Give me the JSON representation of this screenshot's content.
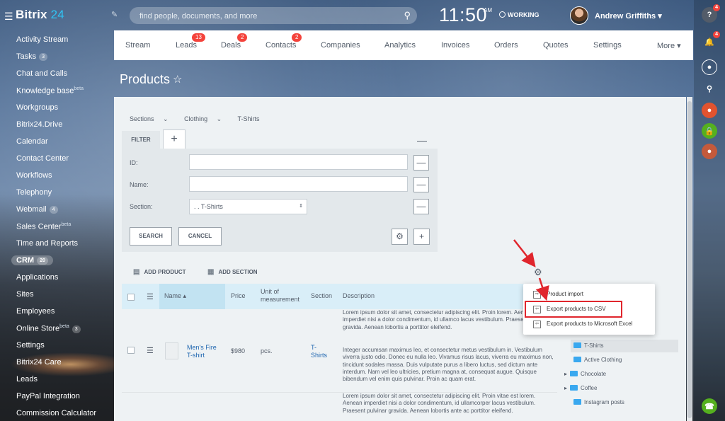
{
  "app": {
    "logo_text": "Bitrix",
    "logo_number": "24"
  },
  "search": {
    "placeholder": "find people, documents, and more"
  },
  "clock": {
    "time": "11:50",
    "ampm": "AM",
    "status": "WORKING"
  },
  "user": {
    "name": "Andrew Griffiths"
  },
  "rightbar": {
    "help_badge": "4",
    "notif_badge": "4"
  },
  "sidebar": {
    "items": [
      {
        "label": "Activity Stream"
      },
      {
        "label": "Tasks",
        "count": "3"
      },
      {
        "label": "Chat and Calls"
      },
      {
        "label": "Knowledge base",
        "sup": "beta"
      },
      {
        "label": "Workgroups"
      },
      {
        "label": "Bitrix24.Drive"
      },
      {
        "label": "Calendar"
      },
      {
        "label": "Contact Center"
      },
      {
        "label": "Workflows"
      },
      {
        "label": "Telephony"
      },
      {
        "label": "Webmail",
        "count": "4"
      },
      {
        "label": "Sales Center",
        "sup": "beta"
      },
      {
        "label": "Time and Reports"
      },
      {
        "label": "CRM",
        "count": "20"
      },
      {
        "label": "Applications"
      },
      {
        "label": "Sites"
      },
      {
        "label": "Employees"
      },
      {
        "label": "Online Store",
        "sup": "beta",
        "count": "3"
      },
      {
        "label": "Settings"
      },
      {
        "label": "Bitrix24 Care"
      },
      {
        "label": "Leads"
      },
      {
        "label": "PayPal Integration"
      },
      {
        "label": "Commission Calculator"
      }
    ]
  },
  "nav": {
    "items": [
      {
        "label": "Stream"
      },
      {
        "label": "Leads",
        "badge": "13"
      },
      {
        "label": "Deals",
        "badge": "2"
      },
      {
        "label": "Contacts",
        "badge": "2"
      },
      {
        "label": "Companies"
      },
      {
        "label": "Analytics"
      },
      {
        "label": "Invoices"
      },
      {
        "label": "Orders"
      },
      {
        "label": "Quotes"
      },
      {
        "label": "Settings"
      },
      {
        "label": "More"
      }
    ]
  },
  "page": {
    "title": "Products"
  },
  "breadcrumb": [
    "Sections",
    "Clothing",
    "T-Shirts"
  ],
  "filter": {
    "tab_label": "FILTER",
    "id_label": "ID:",
    "name_label": "Name:",
    "section_label": "Section:",
    "section_value": ". . T-Shirts",
    "search_button": "SEARCH",
    "cancel_button": "CANCEL"
  },
  "actions": {
    "add_product": "ADD PRODUCT",
    "add_section": "ADD SECTION"
  },
  "table": {
    "headers": {
      "name": "Name",
      "price": "Price",
      "unit": "Unit of measurement",
      "section": "Section",
      "description": "Description"
    },
    "row": {
      "name": "Men's Fire T-shirt",
      "price": "$980",
      "unit": "pcs.",
      "section": "T-Shirts",
      "desc_1": "Lorem ipsum dolor sit amet, consectetur adipiscing elit. Proin lorem. Aenean imperdiet nisi a dolor condimentum, id ullamco lacus vestibulum. Praesent pulvinar gravida. Aenean lobortis a porttitor eleifend.",
      "desc_2": "Integer accumsan maximus leo, et consectetur metus vestibulum in. Vestibulum viverra justo odio. Donec eu nulla leo. Vivamus risus lacus, viverra eu maximus non, tincidunt sodales massa. Duis vulputate purus a libero luctus, sed dictum ante interdum. Nam vel leo ultricies, pretium magna at, consequat augue. Quisque bibendum vel enim quis pulvinar. Proin ac quam erat.",
      "desc_3": "Lorem ipsum dolor sit amet, consectetur adipiscing elit. Proin vitae est lorem. Aenean imperdiet nisi a dolor condimentum, id ullamcorper lacus vestibulum. Praesent pulvinar gravida. Aenean lobortis ante ac porttitor eleifend."
    }
  },
  "tree": [
    "T-Shirts",
    "Active Clothing",
    "Chocolate",
    "Coffee",
    "Instagram posts"
  ],
  "dropdown": {
    "items": [
      "Product import",
      "Export products to CSV",
      "Export products to Microsoft Excel"
    ]
  },
  "colors": {
    "accent": "#2fc6f6",
    "badge": "#f4433c",
    "highlight": "#e0262d",
    "link": "#2067b0"
  }
}
